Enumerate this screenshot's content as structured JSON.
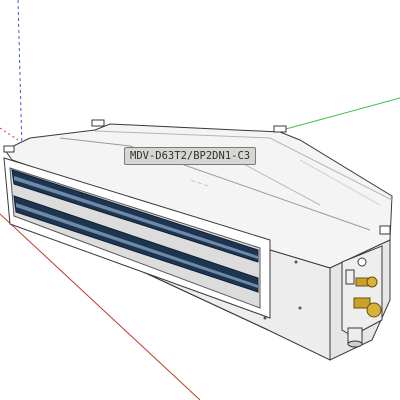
{
  "model": {
    "label": "MDV-D63T2/BP2DN1-C3"
  },
  "axes": {
    "red": "#c0392b",
    "green": "#3fbf3f",
    "blue": "#3c5bd6"
  },
  "colors": {
    "body": "#f4f4f4",
    "body_side": "#e6e6e6",
    "body_front": "#d9d9d9",
    "outline": "#3a3a3a",
    "louver_dark": "#1d3550",
    "louver_light": "#6d8aa8",
    "brass": "#c9a227"
  }
}
